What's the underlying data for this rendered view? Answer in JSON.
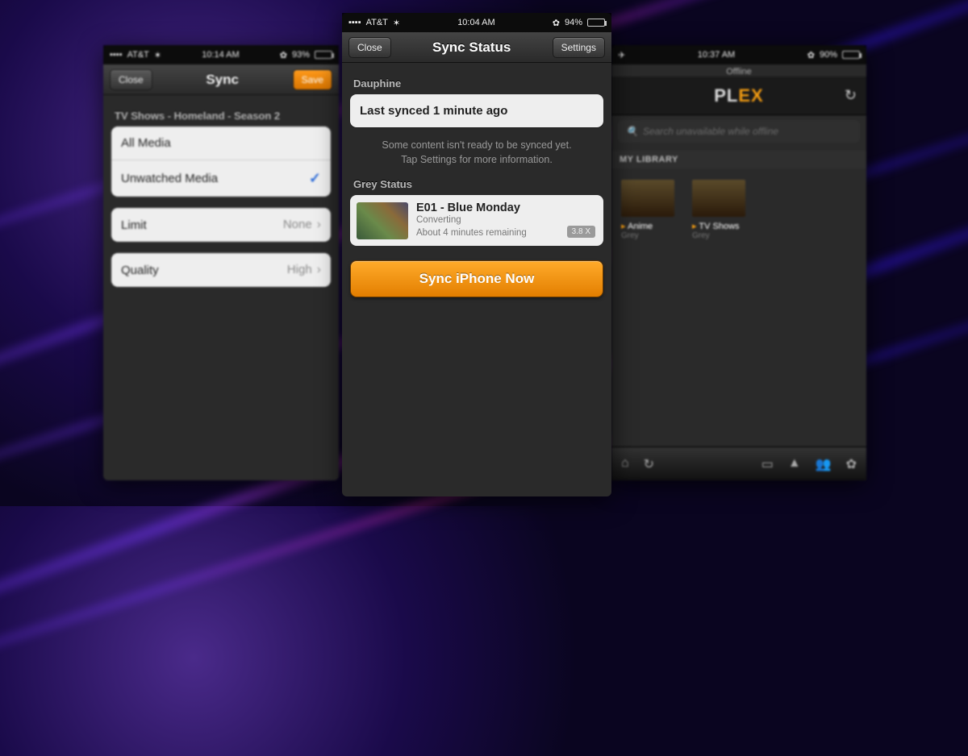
{
  "colors": {
    "accent_orange": "#f39c12",
    "button_orange": "#e88a0a"
  },
  "left": {
    "status": {
      "carrier": "AT&T",
      "time": "10:14 AM",
      "battery": "93%"
    },
    "nav": {
      "close": "Close",
      "title": "Sync",
      "save": "Save"
    },
    "breadcrumb": "TV Shows - Homeland - Season 2",
    "filter": {
      "all": "All Media",
      "unwatched": "Unwatched Media"
    },
    "limit": {
      "label": "Limit",
      "value": "None"
    },
    "quality": {
      "label": "Quality",
      "value": "High"
    }
  },
  "center": {
    "status": {
      "carrier": "AT&T",
      "time": "10:04 AM",
      "battery": "94%"
    },
    "nav": {
      "close": "Close",
      "title": "Sync Status",
      "settings": "Settings"
    },
    "server1": "Dauphine",
    "last_synced": "Last synced 1 minute ago",
    "info_line1": "Some content isn't ready to be synced yet.",
    "info_line2": "Tap Settings for more information.",
    "server2": "Grey Status",
    "item": {
      "title": "E01 - Blue Monday",
      "state": "Converting",
      "eta": "About 4 minutes remaining",
      "badge": "3.8 X"
    },
    "sync_button": "Sync iPhone Now"
  },
  "right": {
    "status": {
      "time": "10:37 AM",
      "battery": "90%",
      "airplane": "✈"
    },
    "offline": "Offline",
    "logo_left": "PL",
    "logo_right": "EX",
    "search_placeholder": "Search unavailable while offline",
    "section": "MY LIBRARY",
    "lib": [
      {
        "name": "Anime",
        "sub": "Grey"
      },
      {
        "name": "TV Shows",
        "sub": "Grey"
      }
    ]
  }
}
